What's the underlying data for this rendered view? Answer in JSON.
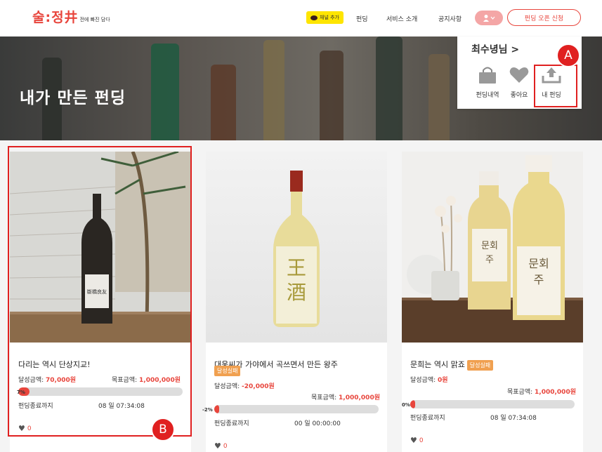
{
  "header": {
    "logo_main": "술:정井",
    "logo_sub": "전에 빠진 담다",
    "kakao": "채널 추가",
    "nav": [
      "펀딩",
      "서비스 소개",
      "공지사항"
    ],
    "open_button": "펀딩 오픈 신청"
  },
  "hero": {
    "title": "내가 만든 펀딩"
  },
  "dropdown": {
    "user": "최수녕님 >",
    "items": [
      {
        "label": "펀딩내역",
        "icon": "shopping-bag-icon"
      },
      {
        "label": "좋아요",
        "icon": "heart-icon"
      },
      {
        "label": "내 펀딩",
        "icon": "upload-icon"
      }
    ]
  },
  "annotations": {
    "a": "A",
    "b": "B"
  },
  "cards": [
    {
      "title": "다리는 역시 단상지교!",
      "badge": "",
      "achieved_label": "달성금액:",
      "achieved_value": "70,000원",
      "goal_label": "목표금액:",
      "goal_value": "1,000,000원",
      "percent": "7%",
      "progress": 0.07,
      "end_label": "펀딩종료까지",
      "remaining": "08 일 07:34:08",
      "likes": "0"
    },
    {
      "title": "대웅씨가 가야에서 곡쓰면서 만든 왕주",
      "badge": "달성실패",
      "achieved_label": "달성금액:",
      "achieved_value": "-20,000원",
      "goal_label": "목표금액:",
      "goal_value": "1,000,000원",
      "percent": "-2%",
      "progress": 0.0,
      "end_label": "펀딩종료까지",
      "remaining": "00 일 00:00:00",
      "likes": "0"
    },
    {
      "title": "문희는 역시 맑죠",
      "badge": "달성실패",
      "achieved_label": "달성금액:",
      "achieved_value": "0원",
      "goal_label": "목표금액:",
      "goal_value": "1,000,000원",
      "percent": "0%",
      "progress": 0.0,
      "end_label": "펀딩종료까지",
      "remaining": "08 일 07:34:08",
      "likes": "0"
    }
  ],
  "colors": {
    "accent": "#e8453c",
    "badge": "#f0a050",
    "annotation": "#e02020"
  }
}
